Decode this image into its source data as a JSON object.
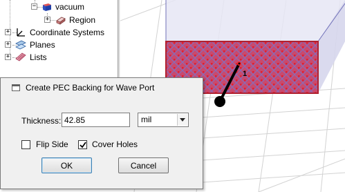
{
  "tree": {
    "items": [
      {
        "label": "vacuum",
        "icon": "material-box-icon"
      },
      {
        "label": "Region",
        "icon": "region-icon"
      },
      {
        "label": "Coordinate Systems",
        "icon": "coordinate-axes-icon"
      },
      {
        "label": "Planes",
        "icon": "planes-icon"
      },
      {
        "label": "Lists",
        "icon": "lists-icon"
      }
    ]
  },
  "viewport": {
    "port_label": "1",
    "colors": {
      "box_fill": "#e4e4f4",
      "port_fill": "#c84a6e",
      "port_border": "#b02030",
      "grid": "#cfcfcf",
      "arrow": "#000000"
    }
  },
  "dialog": {
    "title": "Create PEC Backing for Wave Port",
    "thickness_label": "Thickness:",
    "thickness_value": "42.85",
    "unit_value": "mil",
    "flip_side_label": "Flip Side",
    "flip_side_checked": false,
    "cover_holes_label": "Cover Holes",
    "cover_holes_checked": true,
    "ok_label": "OK",
    "cancel_label": "Cancel"
  }
}
